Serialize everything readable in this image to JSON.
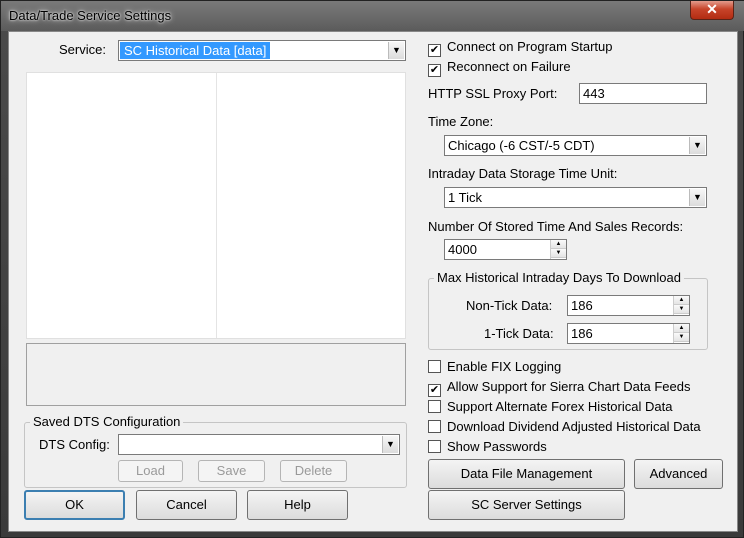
{
  "window": {
    "title": "Data/Trade Service Settings",
    "close_glyph": "✕"
  },
  "service": {
    "label": "Service:",
    "value": "SC Historical Data   [data]"
  },
  "options": {
    "connect_on_startup": {
      "label": "Connect on Program Startup",
      "checked": true
    },
    "reconnect_on_failure": {
      "label": "Reconnect on Failure",
      "checked": true
    }
  },
  "proxy": {
    "label": "HTTP SSL Proxy Port:",
    "value": "443"
  },
  "timezone": {
    "label": "Time Zone:",
    "value": "Chicago (-6 CST/-5 CDT)"
  },
  "intraday_unit": {
    "label": "Intraday Data Storage Time Unit:",
    "value": "1 Tick"
  },
  "time_sales": {
    "label": "Number Of Stored Time And Sales Records:",
    "value": "4000"
  },
  "max_days": {
    "title": "Max Historical Intraday Days To Download",
    "non_tick_label": "Non-Tick Data:",
    "non_tick_value": "186",
    "one_tick_label": "1-Tick Data:",
    "one_tick_value": "186"
  },
  "extra_options": [
    {
      "label": "Enable FIX Logging",
      "checked": false
    },
    {
      "label": "Allow Support for Sierra Chart Data Feeds",
      "checked": true
    },
    {
      "label": "Support Alternate Forex Historical Data",
      "checked": false
    },
    {
      "label": "Download Dividend Adjusted Historical Data",
      "checked": false
    },
    {
      "label": "Show Passwords",
      "checked": false
    }
  ],
  "check_glyph": "✔",
  "dts": {
    "group_title": "Saved DTS Configuration",
    "config_label": "DTS Config:",
    "config_value": "",
    "load": "Load",
    "save": "Save",
    "delete": "Delete"
  },
  "buttons": {
    "ok": "OK",
    "cancel": "Cancel",
    "help": "Help",
    "data_file_management": "Data File Management",
    "advanced": "Advanced",
    "sc_server_settings": "SC Server Settings"
  },
  "arrows": {
    "down": "▼",
    "up_small": "▲",
    "down_small": "▼"
  }
}
